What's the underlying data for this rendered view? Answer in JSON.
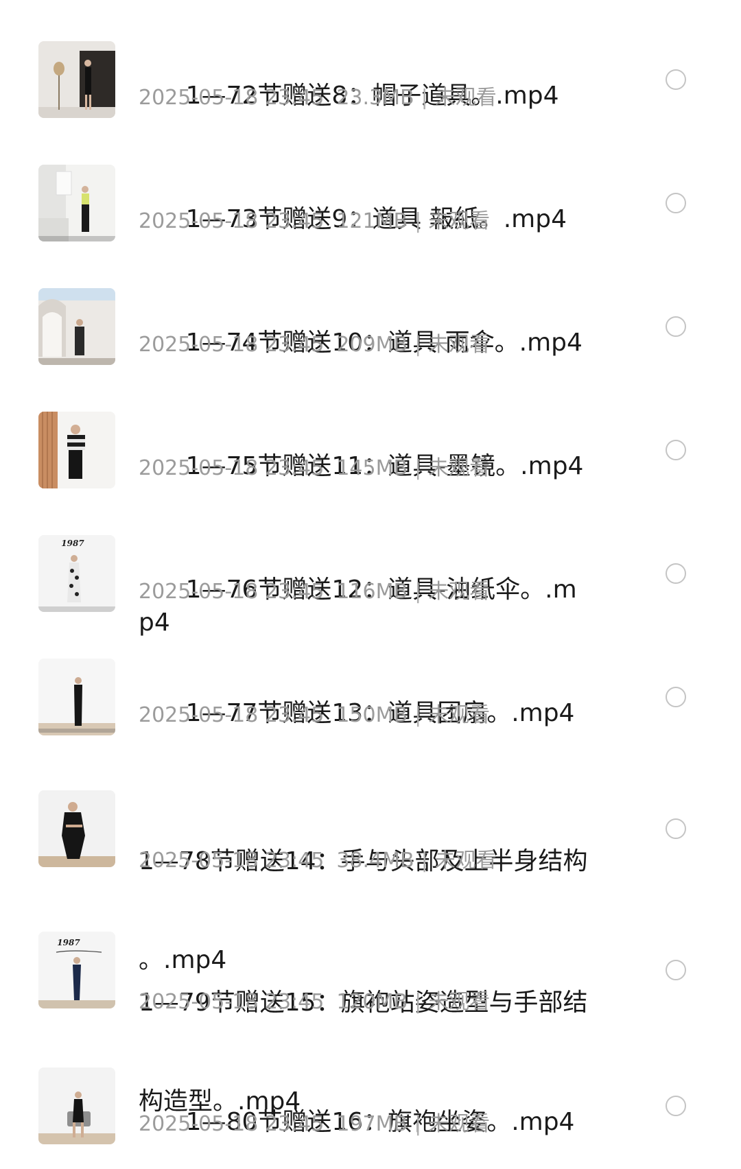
{
  "files": [
    {
      "title_line1": "1—72节赠送8：帽子道具。.mp4",
      "title_line2": "",
      "date": "2025-05-18 23:45",
      "size": "23.3MB",
      "separator": "|",
      "status": "未观看",
      "thumbnail": "video-thumbnail",
      "thumb_caption": ""
    },
    {
      "title_line1": "1—73节赠送9：道具 報紙。.mp4",
      "title_line2": "",
      "date": "2025-05-18 23:45",
      "size": "121MB",
      "separator": "|",
      "status": "未观看",
      "thumbnail": "video-thumbnail",
      "thumb_caption": ""
    },
    {
      "title_line1": "1—74节赠送10：道具 雨伞。.mp4",
      "title_line2": "",
      "date": "2025-05-18 23:45",
      "size": "209MB",
      "separator": "|",
      "status": "未观看",
      "thumbnail": "video-thumbnail",
      "thumb_caption": ""
    },
    {
      "title_line1": "1—75节赠送11：道具-墨镜。.mp4",
      "title_line2": "",
      "date": "2025-05-18 23:45",
      "size": "145MB",
      "separator": "|",
      "status": "未观看",
      "thumbnail": "video-thumbnail",
      "thumb_caption": ""
    },
    {
      "title_line1": "1—76节赠送12：道具-油纸伞。.mp4",
      "title_line2": "",
      "date": "2025-05-18 23:45",
      "size": "116MB",
      "separator": "|",
      "status": "未观看",
      "thumbnail": "video-thumbnail",
      "thumb_caption": "1987"
    },
    {
      "title_line1": "1—77节赠送13：道具团扇。.mp4",
      "title_line2": "",
      "date": "2025-05-18 23:45",
      "size": "150MB",
      "separator": "|",
      "status": "未观看",
      "thumbnail": "video-thumbnail",
      "thumb_caption": ""
    },
    {
      "title_line1": "1—78节赠送14：手与头部及上半身结构",
      "title_line2": "。.mp4",
      "date": "2025-05-18 23:45",
      "size": "38.4MB",
      "separator": "|",
      "status": "未观看",
      "thumbnail": "video-thumbnail",
      "thumb_caption": ""
    },
    {
      "title_line1": "1—79节赠送15：旗袍站姿造型与手部结",
      "title_line2": "构造型。.mp4",
      "date": "2025-05-18 23:45",
      "size": "120MB",
      "separator": "|",
      "status": "未观看",
      "thumbnail": "video-thumbnail",
      "thumb_caption": "1987"
    },
    {
      "title_line1": "1—80节赠送16：旗袍坐姿。.mp4",
      "title_line2": "",
      "date": "2025-05-18 23:45",
      "size": "197MB",
      "separator": "|",
      "status": "未观看",
      "thumbnail": "video-thumbnail",
      "thumb_caption": ""
    }
  ],
  "colors": {
    "title": "#1a1a1a",
    "meta": "#9b9b9b",
    "radio_border": "#c4c4c4",
    "background": "#ffffff"
  },
  "icons": {
    "select": "radio-circle-icon"
  }
}
